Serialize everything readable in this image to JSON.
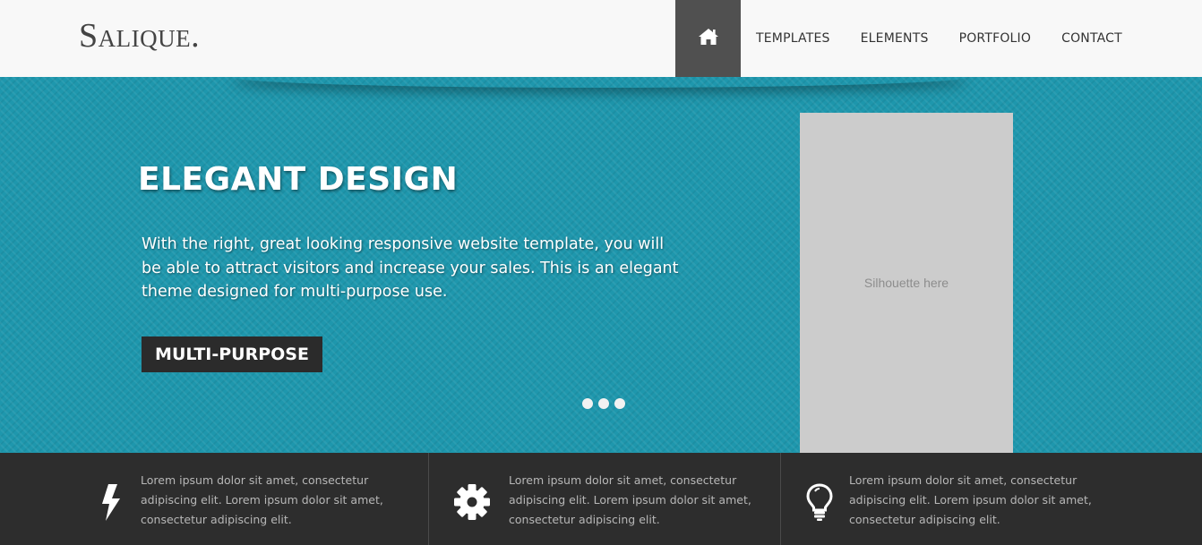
{
  "header": {
    "logo": "Salique.",
    "home_icon": "home-icon",
    "nav": [
      "TEMPLATES",
      "ELEMENTS",
      "PORTFOLIO",
      "CONTACT"
    ]
  },
  "hero": {
    "title": "ELEGANT DESIGN",
    "text": "With the right, great looking responsive website template, you will be able to attract visitors and increase your sales. This is an elegant theme designed for multi-purpose use.",
    "button": "MULTI-PURPOSE",
    "silhouette": "Silhouette here",
    "slide_dots": 3
  },
  "features": [
    {
      "icon": "lightning-icon",
      "text": "Lorem ipsum dolor sit amet, consectetur adipiscing elit. Lorem ipsum dolor sit amet, consectetur adipiscing elit."
    },
    {
      "icon": "gear-icon",
      "text": "Lorem ipsum dolor sit amet, consectetur adipiscing elit. Lorem ipsum dolor sit amet, consectetur adipiscing elit."
    },
    {
      "icon": "lightbulb-icon",
      "text": "Lorem ipsum dolor sit amet, consectetur adipiscing elit. Lorem ipsum dolor sit amet, consectetur adipiscing elit."
    }
  ],
  "colors": {
    "hero_bg": "#1e97ad",
    "dark": "#2d2d2d",
    "nav_home_bg": "#505050"
  }
}
